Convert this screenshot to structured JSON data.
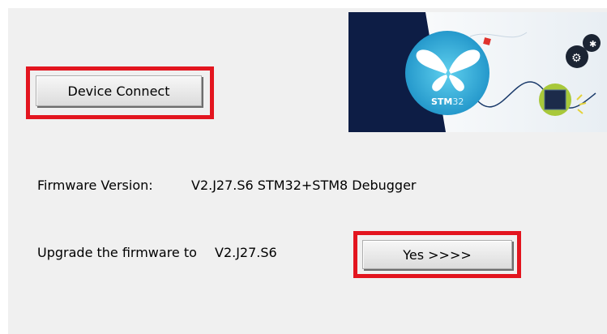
{
  "buttons": {
    "device_connect": "Device Connect",
    "yes": "Yes >>>>"
  },
  "firmware": {
    "version_label": "Firmware Version:",
    "version_value": "V2.J27.S6 STM32+STM8 Debugger"
  },
  "upgrade": {
    "prompt": "Upgrade the firmware to",
    "target_version": "V2.J27.S6"
  },
  "banner": {
    "brand_strong": "STM",
    "brand_light": "32"
  },
  "colors": {
    "highlight": "#e3151f",
    "panel_background": "#f0f0f0",
    "banner_navy": "#0d1d45",
    "brand_cyan": "#3ab4dc"
  }
}
